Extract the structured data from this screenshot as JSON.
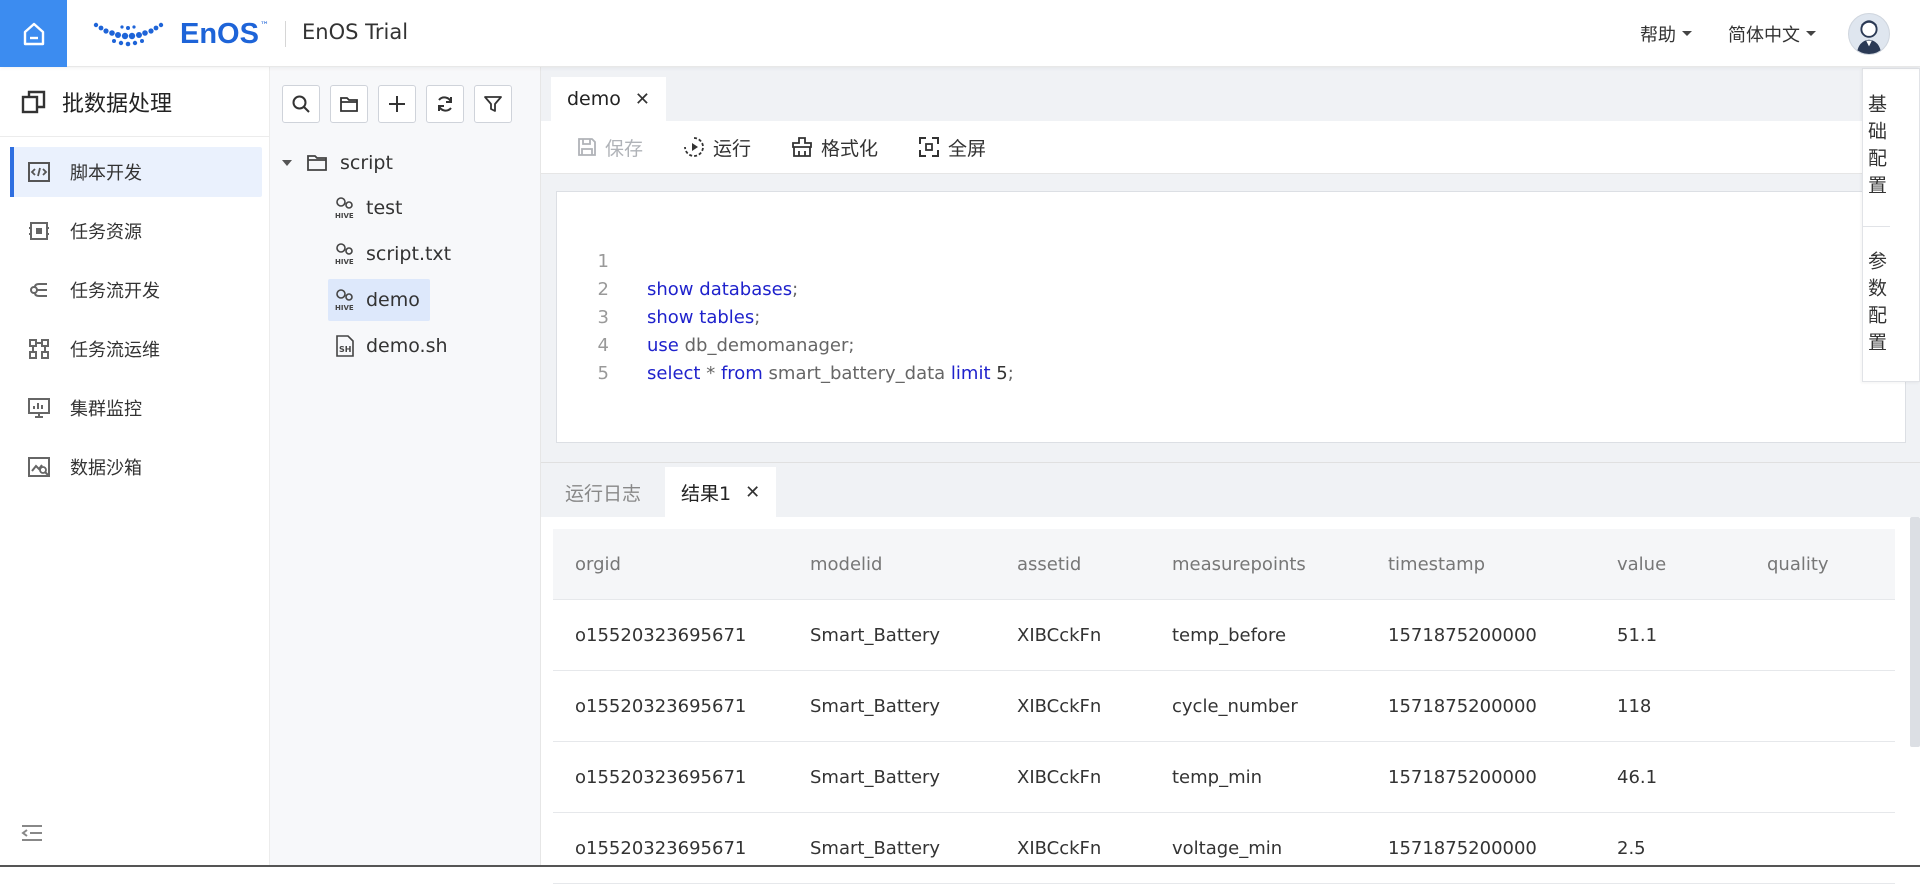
{
  "header": {
    "logo_text": "EnOS",
    "logo_tm": "™",
    "app_title": "EnOS Trial",
    "help_label": "帮助",
    "language_label": "简体中文"
  },
  "nav": {
    "title": "批数据处理",
    "items": [
      {
        "label": "脚本开发",
        "icon": "script-dev-icon",
        "active": true
      },
      {
        "label": "任务资源",
        "icon": "task-resource-icon"
      },
      {
        "label": "任务流开发",
        "icon": "workflow-dev-icon"
      },
      {
        "label": "任务流运维",
        "icon": "workflow-ops-icon"
      },
      {
        "label": "集群监控",
        "icon": "cluster-monitor-icon"
      },
      {
        "label": "数据沙箱",
        "icon": "data-sandbox-icon"
      }
    ]
  },
  "tree": {
    "root": "script",
    "files": [
      {
        "name": "test",
        "type": "hive"
      },
      {
        "name": "script.txt",
        "type": "hive"
      },
      {
        "name": "demo",
        "type": "hive",
        "selected": true
      },
      {
        "name": "demo.sh",
        "type": "sh"
      }
    ]
  },
  "editor": {
    "tab": "demo",
    "toolbar": {
      "save": "保存",
      "run": "运行",
      "format": "格式化",
      "fullscreen": "全屏"
    },
    "lines": [
      "1",
      "2",
      "3",
      "4",
      "5"
    ]
  },
  "side_config": {
    "basic": "基础配置",
    "params": "参数配置"
  },
  "results": {
    "tabs": {
      "log": "运行日志",
      "result": "结果1"
    },
    "columns": [
      "orgid",
      "modelid",
      "assetid",
      "measurepoints",
      "timestamp",
      "value",
      "quality"
    ],
    "rows": [
      [
        "o15520323695671",
        "Smart_Battery",
        "XIBCckFn",
        "temp_before",
        "1571875200000",
        "51.1",
        ""
      ],
      [
        "o15520323695671",
        "Smart_Battery",
        "XIBCckFn",
        "cycle_number",
        "1571875200000",
        "118",
        ""
      ],
      [
        "o15520323695671",
        "Smart_Battery",
        "XIBCckFn",
        "temp_min",
        "1571875200000",
        "46.1",
        ""
      ],
      [
        "o15520323695671",
        "Smart_Battery",
        "XIBCckFn",
        "voltage_min",
        "1571875200000",
        "2.5",
        ""
      ]
    ]
  },
  "colors": {
    "accent": "#3c8cf0",
    "brand": "#1e64d8",
    "keyword": "#1f22cc",
    "active_bg": "#eaf1fd"
  }
}
